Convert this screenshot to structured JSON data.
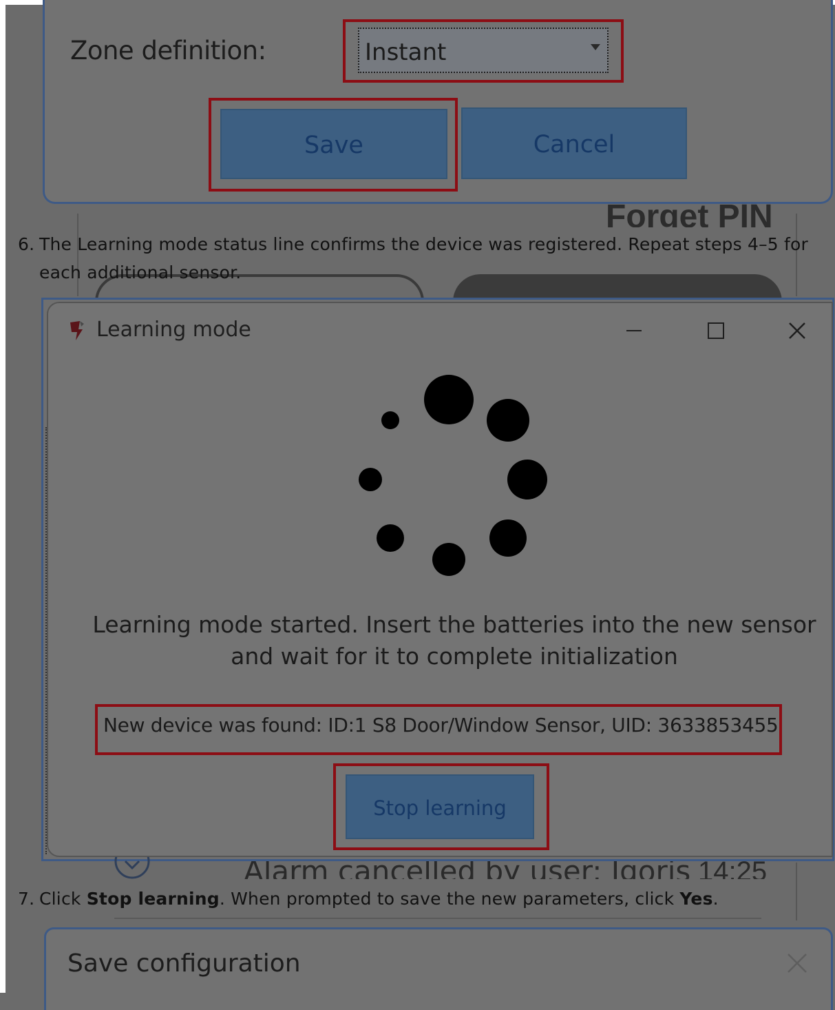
{
  "zone_dialog": {
    "label": "Zone definition:",
    "select_value": "Instant",
    "save_label": "Save",
    "cancel_label": "Cancel"
  },
  "background_app": {
    "forget_pin": "Forget PIN",
    "alarm_text": "Alarm cancelled by user: Igoris",
    "alarm_time": "14:25"
  },
  "steps": [
    {
      "number": "6.",
      "text": "The Learning mode status line confirms the device was registered. Repeat steps 4–5 for each additional sensor."
    },
    {
      "number": "7.",
      "text_before": "Click ",
      "bold_1": "Stop learning",
      "text_middle": ". When prompted to save the new parameters, click ",
      "bold_2": "Yes",
      "text_after": "."
    }
  ],
  "learning_window": {
    "title": "Learning mode",
    "message_line_1": "Learning mode started. Insert the batteries into the new sensor",
    "message_line_2": "and wait for it to complete initialization",
    "status": "New device was found: ID:1 S8 Door/Window Sensor, UID: 3633853455",
    "stop_label": "Stop learning"
  },
  "save_config_dialog": {
    "title": "Save configuration"
  },
  "colors": {
    "highlight": "#8c0d14",
    "button_fill": "#3d5f82",
    "button_text": "#163866",
    "frame_border": "#3e5a86"
  }
}
